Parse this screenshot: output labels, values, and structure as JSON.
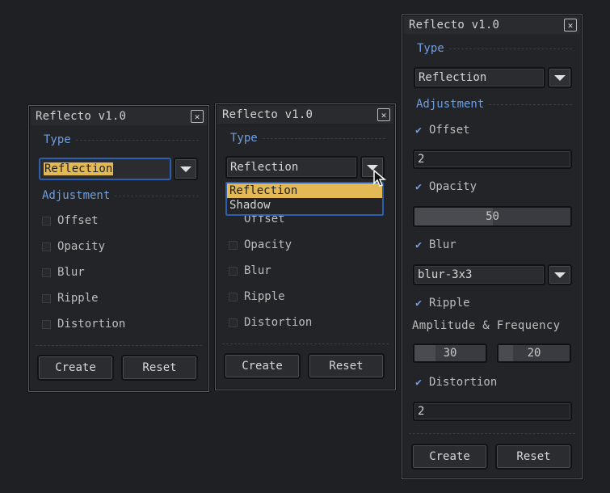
{
  "windows": [
    {
      "title": "Reflecto v1.0",
      "close_label": "☒",
      "type_label": "Type",
      "type_value": "Reflection",
      "adjustment_label": "Adjustment",
      "options": [
        {
          "label": "Offset"
        },
        {
          "label": "Opacity"
        },
        {
          "label": "Blur"
        },
        {
          "label": "Ripple"
        },
        {
          "label": "Distortion"
        }
      ],
      "create_label": "Create",
      "reset_label": "Reset"
    },
    {
      "title": "Reflecto v1.0",
      "type_label": "Type",
      "type_value": "Reflection",
      "dropdown_options": [
        "Reflection",
        "Shadow"
      ],
      "hidden_option_fragment": "Offset",
      "options": [
        {
          "label": "Opacity"
        },
        {
          "label": "Blur"
        },
        {
          "label": "Ripple"
        },
        {
          "label": "Distortion"
        }
      ],
      "create_label": "Create",
      "reset_label": "Reset"
    },
    {
      "title": "Reflecto v1.0",
      "type_label": "Type",
      "type_value": "Reflection",
      "adjustment_label": "Adjustment",
      "offset_label": "Offset",
      "offset_value": "2",
      "opacity_label": "Opacity",
      "opacity_value": "50",
      "blur_label": "Blur",
      "blur_value": "blur-3x3",
      "ripple_label": "Ripple",
      "amp_freq_label": "Amplitude & Frequency",
      "amplitude_value": "30",
      "frequency_value": "20",
      "distortion_label": "Distortion",
      "distortion_value": "2",
      "create_label": "Create",
      "reset_label": "Reset"
    }
  ],
  "colors": {
    "accent": "#6f9ee0",
    "selection": "#e2b955",
    "focus_border": "#2d5fae"
  }
}
